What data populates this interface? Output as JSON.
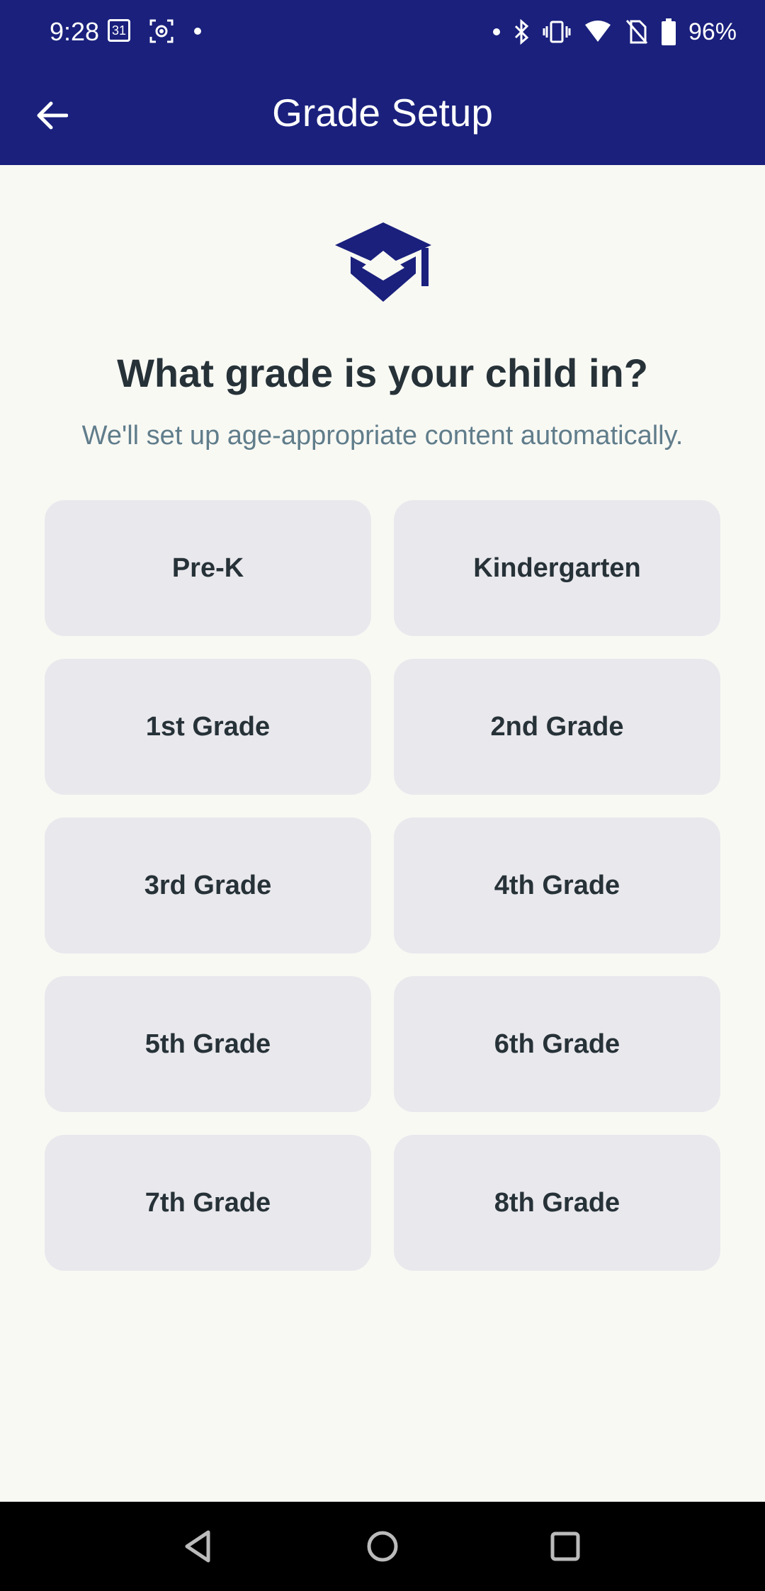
{
  "status_bar": {
    "time": "9:28",
    "calendar_day": "31",
    "battery": "96%"
  },
  "app_bar": {
    "title": "Grade Setup",
    "back_icon": "arrow-back-icon",
    "background_color": "#1a207c"
  },
  "header": {
    "icon": "graduation-cap-icon",
    "question": "What grade is your child in?",
    "subtitle": "We'll set up age-appropriate content automatically."
  },
  "grades": [
    {
      "label": "Pre-K"
    },
    {
      "label": "Kindergarten"
    },
    {
      "label": "1st Grade"
    },
    {
      "label": "2nd Grade"
    },
    {
      "label": "3rd Grade"
    },
    {
      "label": "4th Grade"
    },
    {
      "label": "5th Grade"
    },
    {
      "label": "6th Grade"
    },
    {
      "label": "7th Grade"
    },
    {
      "label": "8th Grade"
    }
  ],
  "nav_bar": {
    "back": "nav-back-icon",
    "home": "nav-home-icon",
    "recents": "nav-recents-icon"
  }
}
